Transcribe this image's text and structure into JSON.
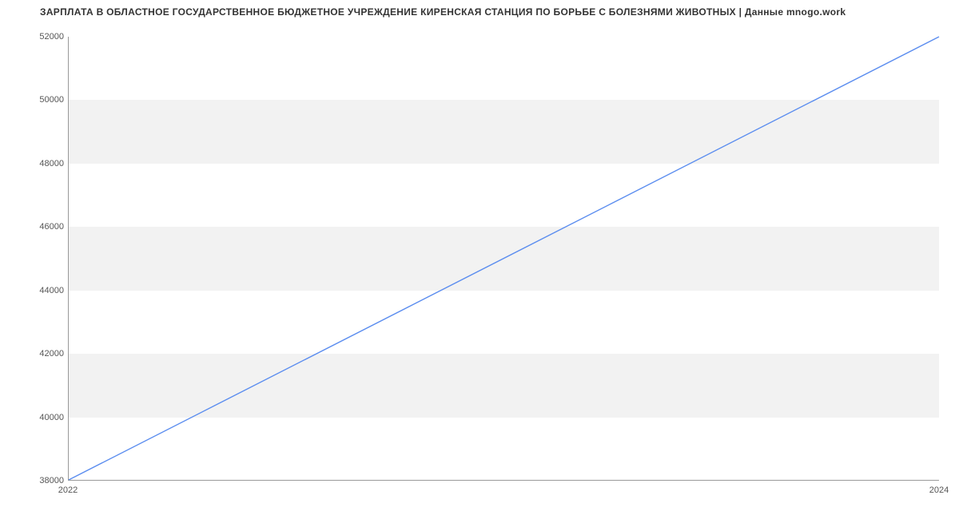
{
  "chart_data": {
    "type": "line",
    "title": "ЗАРПЛАТА В ОБЛАСТНОЕ ГОСУДАРСТВЕННОЕ БЮДЖЕТНОЕ УЧРЕЖДЕНИЕ КИРЕНСКАЯ СТАНЦИЯ ПО БОРЬБЕ С БОЛЕЗНЯМИ ЖИВОТНЫХ | Данные mnogo.work",
    "x": [
      2022,
      2024
    ],
    "values": [
      38000,
      52000
    ],
    "xticks": [
      2022,
      2024
    ],
    "yticks": [
      38000,
      40000,
      42000,
      44000,
      46000,
      48000,
      50000,
      52000
    ],
    "ylim": [
      38000,
      52000
    ],
    "xlim": [
      2022,
      2024
    ],
    "xlabel": "",
    "ylabel": "",
    "bands": [
      [
        40000,
        42000
      ],
      [
        44000,
        46000
      ],
      [
        48000,
        50000
      ]
    ]
  }
}
